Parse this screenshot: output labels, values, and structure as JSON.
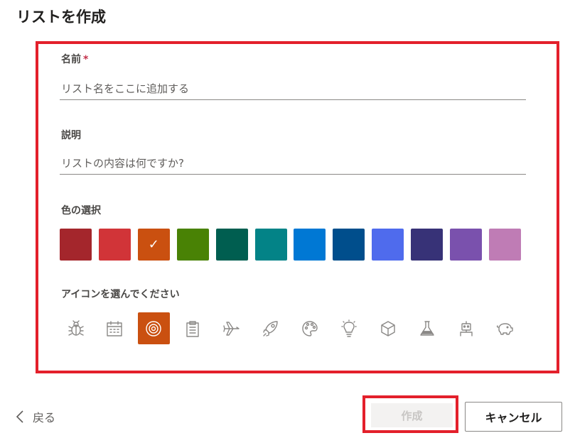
{
  "dialog": {
    "title": "リストを作成"
  },
  "form": {
    "name": {
      "label": "名前",
      "required_mark": "*",
      "placeholder": "リスト名をここに追加する",
      "value": ""
    },
    "description": {
      "label": "説明",
      "placeholder": "リストの内容は何ですか?",
      "value": ""
    },
    "color": {
      "label": "色の選択",
      "selected_index": 2,
      "check_glyph": "✓",
      "swatches": [
        "#a4262c",
        "#d13438",
        "#ca5010",
        "#498205",
        "#005e50",
        "#038387",
        "#0078d4",
        "#004e8c",
        "#4f6bed",
        "#373277",
        "#7a51ad",
        "#bf7cb5"
      ]
    },
    "icon": {
      "label": "アイコンを選んでください",
      "selected_index": 2,
      "selected_bg": "#ca5010",
      "items": [
        "bug-icon",
        "calendar-icon",
        "target-icon",
        "clipboard-icon",
        "airplane-icon",
        "rocket-icon",
        "palette-icon",
        "lightbulb-icon",
        "cube-icon",
        "beaker-icon",
        "robot-icon",
        "piggy-bank-icon"
      ]
    }
  },
  "footer": {
    "back_label": "戻る",
    "create_label": "作成",
    "cancel_label": "キャンセル"
  }
}
